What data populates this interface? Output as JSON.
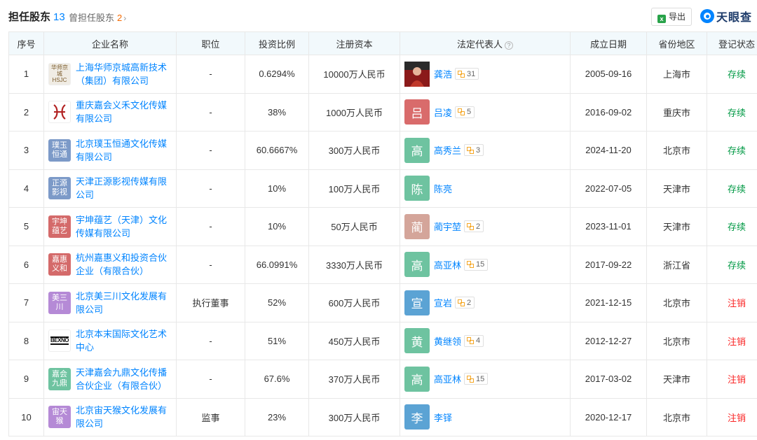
{
  "header": {
    "title": "担任股东",
    "count": "13",
    "former_label": "曾担任股东",
    "former_count": "2",
    "former_chevron": "›",
    "export_label": "导出",
    "export_icon": "excel-icon",
    "brand": "天眼查"
  },
  "columns": [
    "序号",
    "企业名称",
    "职位",
    "投资比例",
    "注册资本",
    "法定代表人",
    "成立日期",
    "省份地区",
    "登记状态"
  ],
  "help_glyph": "?",
  "rows": [
    {
      "no": "1",
      "logo_text": "华师京城 HSJC",
      "logo_bg": "#f0ece4",
      "logo_color": "#7a5a2a",
      "company": "上海华师京城高新技术（集团）有限公司",
      "position": "-",
      "ratio": "0.6294%",
      "capital": "10000万人民币",
      "rep": "龚浩",
      "rep_avatar": "",
      "avatar_bg": "#c0392b",
      "rep_count": "31",
      "date": "2005-09-16",
      "region": "上海市",
      "status": "存续",
      "status_type": "active"
    },
    {
      "no": "2",
      "logo_text": "",
      "logo_bg": "#ffffff",
      "logo_color": "#b22222",
      "company": "重庆嘉会义禾文化传媒有限公司",
      "position": "-",
      "ratio": "38%",
      "capital": "1000万人民币",
      "rep": "吕凌",
      "rep_avatar": "吕",
      "avatar_bg": "#d96b6b",
      "rep_count": "5",
      "date": "2016-09-02",
      "region": "重庆市",
      "status": "存续",
      "status_type": "active"
    },
    {
      "no": "3",
      "logo_text": "璞玉恒通",
      "logo_bg": "#7c9ac8",
      "logo_color": "#ffffff",
      "company": "北京璞玉恒通文化传媒有限公司",
      "position": "-",
      "ratio": "60.6667%",
      "capital": "300万人民币",
      "rep": "高秀兰",
      "rep_avatar": "高",
      "avatar_bg": "#6ec3a0",
      "rep_count": "3",
      "date": "2024-11-20",
      "region": "北京市",
      "status": "存续",
      "status_type": "active"
    },
    {
      "no": "4",
      "logo_text": "正源影视",
      "logo_bg": "#7c9ac8",
      "logo_color": "#ffffff",
      "company": "天津正源影视传媒有限公司",
      "position": "-",
      "ratio": "10%",
      "capital": "100万人民币",
      "rep": "陈亮",
      "rep_avatar": "陈",
      "avatar_bg": "#6ec3a0",
      "rep_count": "",
      "date": "2022-07-05",
      "region": "天津市",
      "status": "存续",
      "status_type": "active"
    },
    {
      "no": "5",
      "logo_text": "宇坤蕴艺",
      "logo_bg": "#d46a6a",
      "logo_color": "#ffffff",
      "company": "宇坤蕴艺（天津）文化传媒有限公司",
      "position": "-",
      "ratio": "10%",
      "capital": "50万人民币",
      "rep": "蔺宇堃",
      "rep_avatar": "蔺",
      "avatar_bg": "#d4a59a",
      "rep_count": "2",
      "date": "2023-11-01",
      "region": "天津市",
      "status": "存续",
      "status_type": "active"
    },
    {
      "no": "6",
      "logo_text": "嘉惠义和",
      "logo_bg": "#d46a6a",
      "logo_color": "#ffffff",
      "company": "杭州嘉惠义和投资合伙企业（有限合伙）",
      "position": "-",
      "ratio": "66.0991%",
      "capital": "3330万人民币",
      "rep": "高亚林",
      "rep_avatar": "高",
      "avatar_bg": "#6ec3a0",
      "rep_count": "15",
      "date": "2017-09-22",
      "region": "浙江省",
      "status": "存续",
      "status_type": "active"
    },
    {
      "no": "7",
      "logo_text": "美三川",
      "logo_bg": "#b58ad6",
      "logo_color": "#ffffff",
      "company": "北京美三川文化发展有限公司",
      "position": "执行董事",
      "ratio": "52%",
      "capital": "600万人民币",
      "rep": "宣岩",
      "rep_avatar": "宣",
      "avatar_bg": "#5ba3d4",
      "rep_count": "2",
      "date": "2021-12-15",
      "region": "北京市",
      "status": "注销",
      "status_type": "cancel"
    },
    {
      "no": "8",
      "logo_text": "BEXNO",
      "logo_bg": "#ffffff",
      "logo_color": "#111111",
      "company": "北京本末国际文化艺术中心",
      "position": "-",
      "ratio": "51%",
      "capital": "450万人民币",
      "rep": "黄继领",
      "rep_avatar": "黄",
      "avatar_bg": "#6ec3a0",
      "rep_count": "4",
      "date": "2012-12-27",
      "region": "北京市",
      "status": "注销",
      "status_type": "cancel"
    },
    {
      "no": "9",
      "logo_text": "嘉会九鼎",
      "logo_bg": "#6ec3a0",
      "logo_color": "#ffffff",
      "company": "天津嘉会九鼎文化传播合伙企业（有限合伙）",
      "position": "-",
      "ratio": "67.6%",
      "capital": "370万人民币",
      "rep": "高亚林",
      "rep_avatar": "高",
      "avatar_bg": "#6ec3a0",
      "rep_count": "15",
      "date": "2017-03-02",
      "region": "天津市",
      "status": "注销",
      "status_type": "cancel"
    },
    {
      "no": "10",
      "logo_text": "宙天猴",
      "logo_bg": "#b58ad6",
      "logo_color": "#ffffff",
      "company": "北京宙天猴文化发展有限公司",
      "position": "监事",
      "ratio": "23%",
      "capital": "300万人民币",
      "rep": "李铎",
      "rep_avatar": "李",
      "avatar_bg": "#5ba3d4",
      "rep_count": "",
      "date": "2020-12-17",
      "region": "北京市",
      "status": "注销",
      "status_type": "cancel"
    }
  ]
}
